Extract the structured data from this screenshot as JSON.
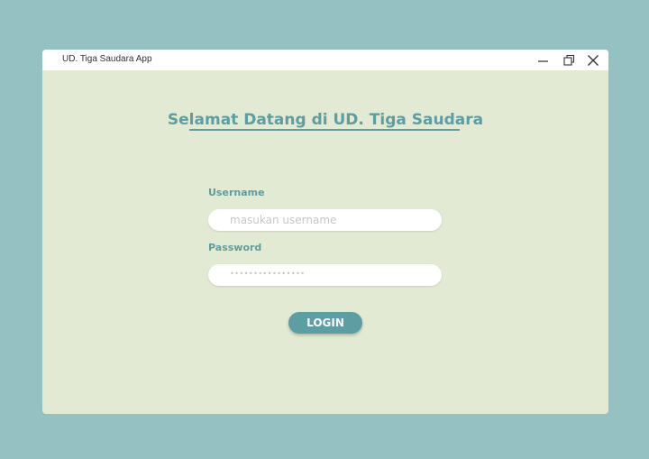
{
  "window": {
    "title": "UD. Tiga Saudara App",
    "controls": {
      "minimize_icon": "minimize-icon",
      "restore_icon": "restore-icon",
      "close_icon": "close-icon"
    }
  },
  "main": {
    "welcome_text": "Selamat Datang di UD. Tiga Saudara",
    "username_label": "Username",
    "username_placeholder": "masukan username",
    "username_value": "",
    "password_label": "Password",
    "password_display": "••••••••••••••••",
    "login_label": "LOGIN"
  },
  "colors": {
    "background": "#95c1c3",
    "window_body": "#e3ead4",
    "accent": "#5c9ea2",
    "titlebar": "#ffffff"
  }
}
